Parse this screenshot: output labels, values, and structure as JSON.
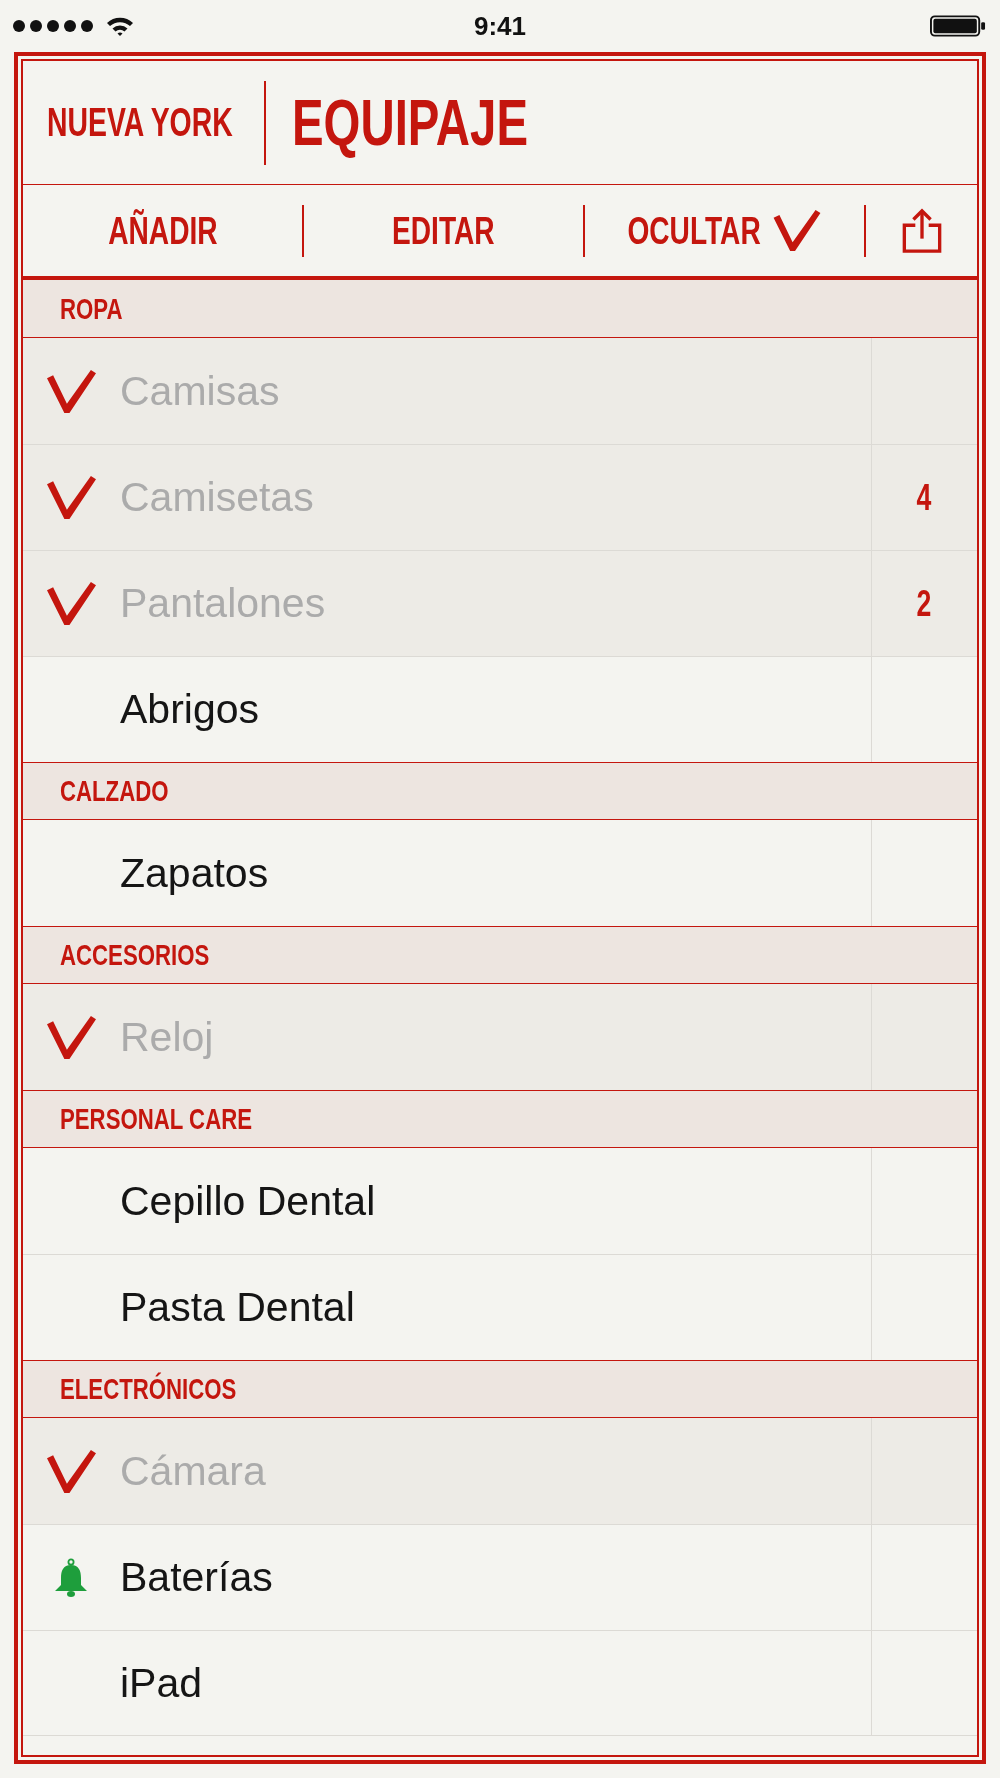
{
  "status_bar": {
    "time": "9:41"
  },
  "header": {
    "city": "NUEVA YORK",
    "title": "EQUIPAJE"
  },
  "toolbar": [
    {
      "kind": "text",
      "label": "AÑADIR"
    },
    {
      "kind": "text",
      "label": "EDITAR"
    },
    {
      "kind": "toggle",
      "label": "OCULTAR",
      "checked": true
    },
    {
      "kind": "share"
    }
  ],
  "sections": [
    {
      "title": "ROPA",
      "items": [
        {
          "name": "Camisas",
          "checked": true,
          "alert": false
        },
        {
          "name": "Camisetas",
          "checked": true,
          "alert": false,
          "count": "4"
        },
        {
          "name": "Pantalones",
          "checked": true,
          "alert": false,
          "count": "2"
        },
        {
          "name": "Abrigos",
          "checked": false,
          "alert": false
        }
      ]
    },
    {
      "title": "CALZADO",
      "items": [
        {
          "name": "Zapatos",
          "checked": false,
          "alert": false
        }
      ]
    },
    {
      "title": "ACCESORIOS",
      "items": [
        {
          "name": "Reloj",
          "checked": true,
          "alert": false
        }
      ]
    },
    {
      "title": "PERSONAL CARE",
      "items": [
        {
          "name": "Cepillo Dental",
          "checked": false,
          "alert": false
        },
        {
          "name": "Pasta Dental",
          "checked": false,
          "alert": false
        }
      ]
    },
    {
      "title": "ELECTRÓNICOS",
      "items": [
        {
          "name": "Cámara",
          "checked": true,
          "alert": false
        },
        {
          "name": "Baterías",
          "checked": false,
          "alert": true
        },
        {
          "name": "iPad",
          "checked": false,
          "alert": false
        }
      ]
    }
  ]
}
